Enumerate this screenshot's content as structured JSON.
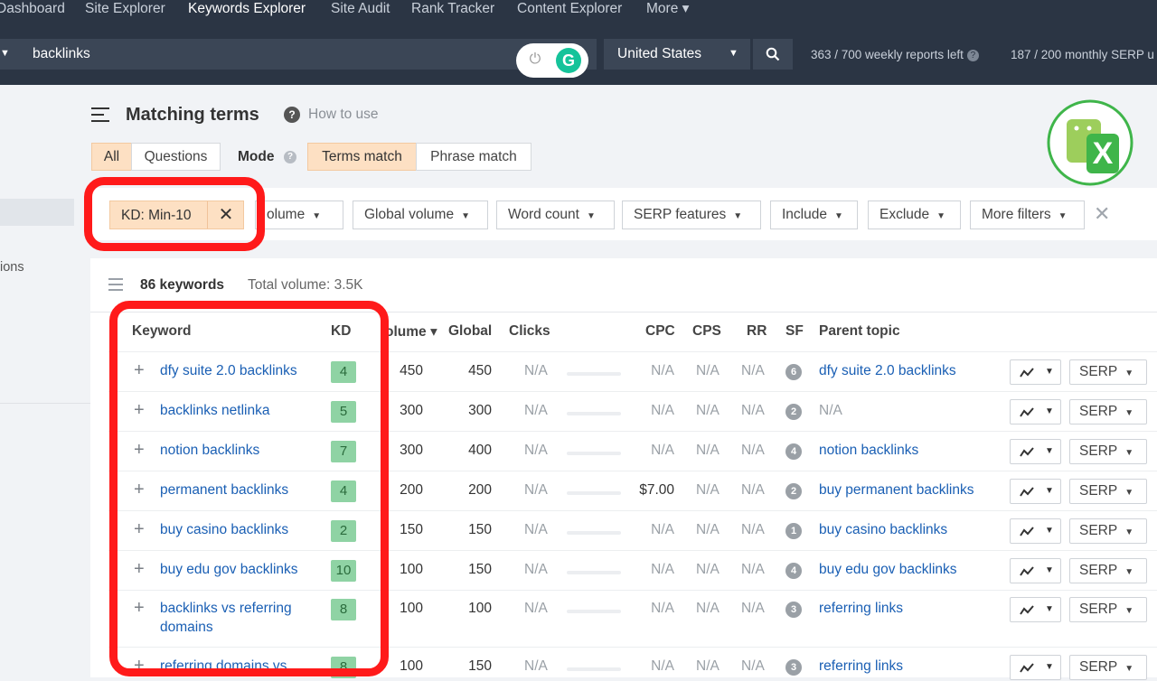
{
  "nav": {
    "items": [
      "Dashboard",
      "Site Explorer",
      "Keywords Explorer",
      "Site Audit",
      "Rank Tracker",
      "Content Explorer",
      "More"
    ],
    "more_caret": "▾"
  },
  "search": {
    "value": "backlinks",
    "country": "United States"
  },
  "quota": {
    "weekly": "363 / 700 weekly reports left",
    "monthly": "187 / 200 monthly SERP u"
  },
  "sidebar": {
    "partial_label": "ions"
  },
  "header": {
    "title": "Matching terms",
    "how_to": "How to use",
    "help_glyph": "?"
  },
  "tabs": {
    "all": "All",
    "questions": "Questions",
    "mode_label": "Mode",
    "terms_match": "Terms match",
    "phrase_match": "Phrase match"
  },
  "filters": {
    "kd_chip": "KD: Min-10",
    "volume": "olume",
    "global_volume": "Global volume",
    "word_count": "Word count",
    "serp_features": "SERP features",
    "include": "Include",
    "exclude": "Exclude",
    "more_filters": "More filters"
  },
  "summary": {
    "count": "86 keywords",
    "total": "Total volume: 3.5K"
  },
  "columns": {
    "keyword": "Keyword",
    "kd": "KD",
    "volume": "olume ▾",
    "global": "Global",
    "clicks": "Clicks",
    "cpc": "CPC",
    "cps": "CPS",
    "rr": "RR",
    "sf": "SF",
    "parent": "Parent topic"
  },
  "serp_label": "SERP",
  "rows": [
    {
      "kw1": "dfy suite 2.0 backlinks",
      "kw2": "",
      "kd": "4",
      "volume": "450",
      "global": "450",
      "clicks": "N/A",
      "cpc": "N/A",
      "cps": "N/A",
      "rr": "N/A",
      "sf": "6",
      "parent": "dfy suite 2.0 backlinks"
    },
    {
      "kw1": "backlinks netlinka",
      "kw2": "",
      "kd": "5",
      "volume": "300",
      "global": "300",
      "clicks": "N/A",
      "cpc": "N/A",
      "cps": "N/A",
      "rr": "N/A",
      "sf": "2",
      "parent": "N/A"
    },
    {
      "kw1": "notion backlinks",
      "kw2": "",
      "kd": "7",
      "volume": "300",
      "global": "400",
      "clicks": "N/A",
      "cpc": "N/A",
      "cps": "N/A",
      "rr": "N/A",
      "sf": "4",
      "parent": "notion backlinks"
    },
    {
      "kw1": "permanent backlinks",
      "kw2": "",
      "kd": "4",
      "volume": "200",
      "global": "200",
      "clicks": "N/A",
      "cpc": "$7.00",
      "cps": "N/A",
      "rr": "N/A",
      "sf": "2",
      "parent": "buy permanent backlinks"
    },
    {
      "kw1": "buy casino backlinks",
      "kw2": "",
      "kd": "2",
      "volume": "150",
      "global": "150",
      "clicks": "N/A",
      "cpc": "N/A",
      "cps": "N/A",
      "rr": "N/A",
      "sf": "1",
      "parent": "buy casino backlinks"
    },
    {
      "kw1": "buy edu gov backlinks",
      "kw2": "",
      "kd": "10",
      "volume": "100",
      "global": "150",
      "clicks": "N/A",
      "cpc": "N/A",
      "cps": "N/A",
      "rr": "N/A",
      "sf": "4",
      "parent": "buy edu gov backlinks"
    },
    {
      "kw1": "backlinks vs referring",
      "kw2": "domains",
      "kd": "8",
      "volume": "100",
      "global": "100",
      "clicks": "N/A",
      "cpc": "N/A",
      "cps": "N/A",
      "rr": "N/A",
      "sf": "3",
      "parent": "referring links"
    },
    {
      "kw1": "referring domains vs",
      "kw2": "",
      "kd": "8",
      "volume": "100",
      "global": "150",
      "clicks": "N/A",
      "cpc": "N/A",
      "cps": "N/A",
      "rr": "N/A",
      "sf": "3",
      "parent": "referring links"
    }
  ],
  "colors": {
    "nav_bg": "#2b3544",
    "accent_orange": "#fde0c3",
    "link_blue": "#1a5fb4",
    "kd_green": "#8fd3a4",
    "highlight_red": "#ff1a1a"
  }
}
